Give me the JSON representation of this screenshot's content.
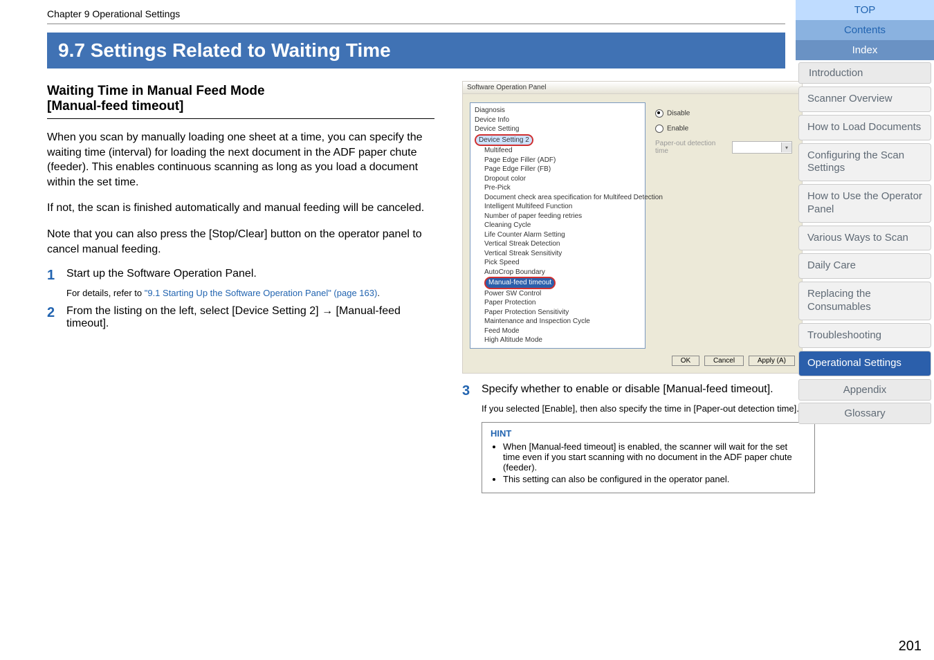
{
  "chapter_header": "Chapter 9 Operational Settings",
  "section_title": "9.7 Settings Related to Waiting Time",
  "subheading_line1": "Waiting Time in Manual Feed Mode",
  "subheading_line2": "[Manual-feed timeout]",
  "body_p1": "When you scan by manually loading one sheet at a time, you can specify the waiting time (interval) for loading the next document in the ADF paper chute (feeder). This enables continuous scanning as long as you load a document within the set time.",
  "body_p2": "If not, the scan is finished automatically and manual feeding will be canceled.",
  "body_p3": "Note that you can also press the [Stop/Clear] button on the operator panel to cancel manual feeding.",
  "steps": {
    "s1_num": "1",
    "s1_text": "Start up the Software Operation Panel.",
    "s1_detail_lead": "For details, refer to ",
    "s1_link": "\"9.1 Starting Up the Software Operation Panel\" (page 163)",
    "s1_detail_tail": ".",
    "s2_num": "2",
    "s2_text": "From the listing on the left, select [Device Setting 2] → [Manual-feed timeout].",
    "s3_num": "3",
    "s3_text": "Specify whether to enable or disable [Manual-feed timeout].",
    "s3_detail": "If you selected [Enable], then also specify the time in [Paper-out detection time]."
  },
  "hint": {
    "title": "HINT",
    "b1": "When [Manual-feed timeout] is enabled, the scanner will wait for the set time even if you start scanning with no document in the ADF paper chute (feeder).",
    "b2": "This setting can also be configured in the operator panel."
  },
  "sop": {
    "title": "Software Operation Panel",
    "tree": {
      "diagnosis": "Diagnosis",
      "device_info": "Device Info",
      "device_setting": "Device Setting",
      "device_setting2": "Device Setting 2",
      "multifeed": "Multifeed",
      "page_edge_adf": "Page Edge Filler (ADF)",
      "page_edge_fb": "Page Edge Filler (FB)",
      "dropout": "Dropout color",
      "prepick": "Pre-Pick",
      "doc_check": "Document check area specification for Multifeed Detection",
      "int_mf": "Intelligent Multifeed Function",
      "num_retries": "Number of paper feeding retries",
      "cleaning": "Cleaning Cycle",
      "life_counter": "Life Counter Alarm Setting",
      "vs_detect": "Vertical Streak Detection",
      "vs_sens": "Vertical Streak Sensitivity",
      "pick_speed": "Pick Speed",
      "autocrop": "AutoCrop Boundary",
      "manual_feed": "Manual-feed timeout",
      "power_sw": "Power SW Control",
      "paper_prot": "Paper Protection",
      "paper_prot_sens": "Paper Protection Sensitivity",
      "maint": "Maintenance and Inspection Cycle",
      "feed_mode": "Feed Mode",
      "high_alt": "High Altitude Mode"
    },
    "right": {
      "disable": "Disable",
      "enable": "Enable",
      "paper_out_label": "Paper-out detection time"
    },
    "buttons": {
      "ok": "OK",
      "cancel": "Cancel",
      "apply": "Apply (A)"
    }
  },
  "nav": {
    "top": "TOP",
    "contents": "Contents",
    "index": "Index",
    "intro": "Introduction",
    "b1": "Scanner Overview",
    "b2": "How to Load Documents",
    "b3": "Configuring the Scan Settings",
    "b4": "How to Use the Operator Panel",
    "b5": "Various Ways to Scan",
    "b6": "Daily Care",
    "b7": "Replacing the Consumables",
    "b8": "Troubleshooting",
    "b9": "Operational Settings",
    "appendix": "Appendix",
    "glossary": "Glossary"
  },
  "page_num": "201"
}
